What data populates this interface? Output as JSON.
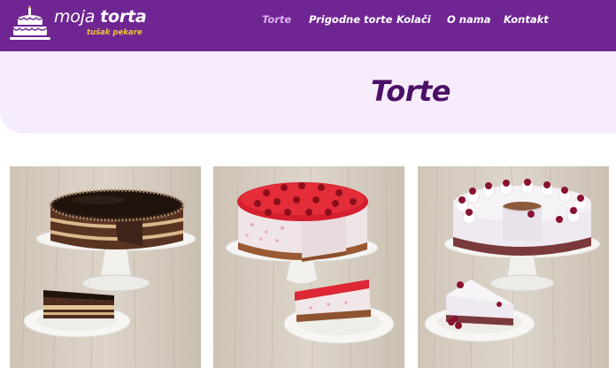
{
  "header": {
    "logo": {
      "name_regular": "moja",
      "name_bold": "torta",
      "tagline": "tušak pekare"
    },
    "nav": [
      {
        "label": "Torte",
        "active": true
      },
      {
        "label": "Prigodne torte",
        "active": false
      },
      {
        "label": "Kolači",
        "active": false
      },
      {
        "label": "O nama",
        "active": false
      },
      {
        "label": "Kontakt",
        "active": false
      }
    ]
  },
  "page": {
    "title": "Torte"
  },
  "colors": {
    "brand_purple": "#6f2592",
    "title_purple": "#4b1166",
    "band_background": "#f7ecfb",
    "logo_tagline_yellow": "#f3c23a"
  },
  "products": [
    {
      "image": "chocolate-layer-cake-photo"
    },
    {
      "image": "strawberry-cheesecake-photo"
    },
    {
      "image": "cherry-cream-ring-cake-photo"
    }
  ]
}
